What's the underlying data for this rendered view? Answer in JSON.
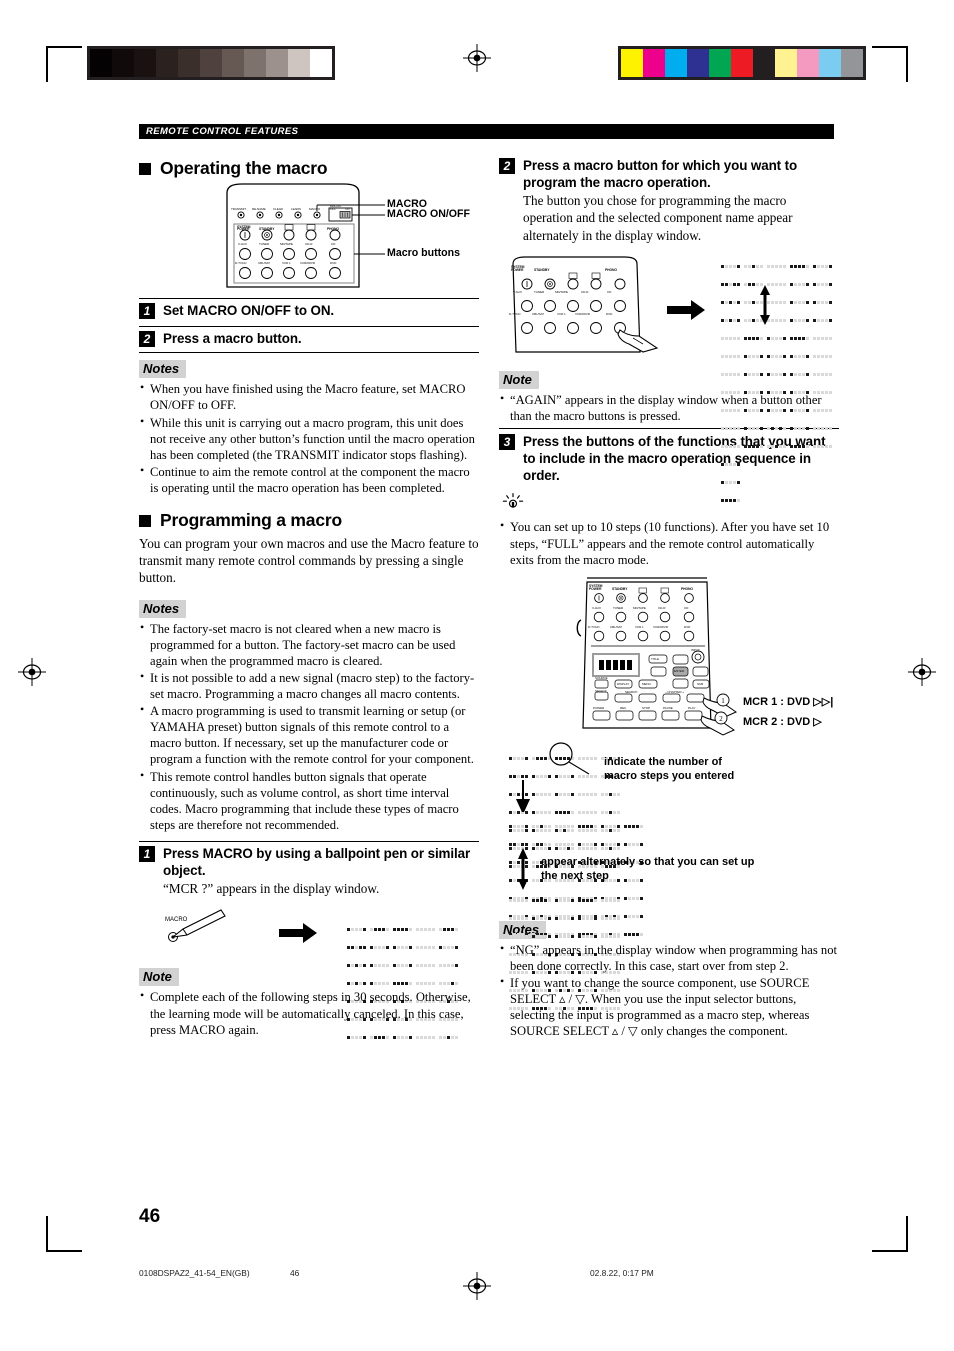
{
  "page": {
    "number": "46",
    "section_bar": "REMOTE CONTROL FEATURES",
    "footer_file": "0108DSPAZ2_41-54_EN(GB)",
    "footer_page": "46",
    "footer_date": "02.8.22, 0:17 PM"
  },
  "colors": {
    "bar_background": "#231f20",
    "notes_chip": "#d2d2d2",
    "ink": "#000000",
    "paper": "#ffffff"
  },
  "calibration": {
    "gray_swatches": [
      "#050203",
      "#100a0b",
      "#1a1211",
      "#2b211f",
      "#3b2f2c",
      "#4f423e",
      "#665853",
      "#7e726d",
      "#9c918c",
      "#cec5c1",
      "#ffffff"
    ],
    "color_swatches": [
      "#fff200",
      "#ec008c",
      "#00aeef",
      "#2e3192",
      "#00a651",
      "#ed1c24",
      "#231f20",
      "#fff391",
      "#f49ac1",
      "#7accf1",
      "#939598"
    ]
  },
  "left_column": {
    "heading": "Operating the macro",
    "figure": {
      "callouts": [
        "MACRO",
        "MACRO ON/OFF",
        "Macro buttons"
      ],
      "switch_labels": {
        "title": "MACRO ON/OFF",
        "off": "OFF",
        "on": "ON"
      },
      "top_row_labels": [
        "TRANSMIT",
        "RE-NAME",
        "CLEAR",
        "LEARN",
        "MACRO"
      ],
      "source_rows": [
        [
          "SYSTEM POWER",
          "STANDBY",
          "A",
          "B",
          "PHONO"
        ],
        [
          "V-AUX",
          "TUNER",
          "MD/TAPE",
          "CD-R",
          "CD"
        ],
        [
          "D-TV/LD",
          "CBL/SAT",
          "VCR 1",
          "VCR2/DVR",
          "DVD"
        ]
      ]
    },
    "steps": [
      {
        "num": "1",
        "title": "Set MACRO ON/OFF to ON."
      },
      {
        "num": "2",
        "title": "Press a macro button."
      }
    ],
    "notes_label": "Notes",
    "notes": [
      "When you have finished using the Macro feature, set MACRO ON/OFF to OFF.",
      "While this unit is carrying out a macro program, this unit does not receive any other button’s function until the macro operation has been completed (the TRANSMIT indicator stops flashing).",
      "Continue to aim the remote control at the component the macro is operating until the macro operation has been completed."
    ],
    "heading2": "Programming a macro",
    "intro2": "You can program your own macros and use the Macro feature to transmit many remote control commands by pressing a single button.",
    "notes_label2": "Notes",
    "notes2": [
      "The factory-set macro is not cleared when a new macro is programmed for a button. The factory-set macro can be used again when the programmed macro is cleared.",
      "It is not possible to add a new signal (macro step) to the factory-set macro. Programming a macro changes all macro contents.",
      "A macro programming is used to transmit learning or setup (or YAMAHA preset) button signals of this remote control to a macro button. If necessary, set up the manufacturer code or program a function with the remote control for your component.",
      "This remote control handles button signals that operate continuously, such as volume control, as short time interval codes. Macro programming that include these types of macro steps are therefore not recommended."
    ],
    "step1": {
      "num": "1",
      "title": "Press MACRO by using a ballpoint pen or similar object.",
      "sub": "“MCR ?” appears in the display window.",
      "pen_label": "MACRO",
      "display_text": "MCR ?"
    },
    "note_label3": "Note",
    "notes3": [
      "Complete each of the following steps in 30 seconds. Otherwise, the learning mode will be automatically canceled. In this case, press MACRO again."
    ]
  },
  "right_column": {
    "step2": {
      "num": "2",
      "title": "Press a macro button for which you want to program the macro operation.",
      "sub": "The button you chose for programming the macro operation and the selected component name appear alternately in the display window.",
      "display_top": "M1 DVD",
      "display_bottom": "DVD"
    },
    "note_label": "Note",
    "notes": [
      "“AGAIN” appears in the display window when a button other than the macro buttons is pressed."
    ],
    "step3": {
      "num": "3",
      "title": "Press the buttons of the functions that you want to include in the macro operation sequence in order.",
      "tip": "You can set up to 10 steps (10 functions). After you have set 10 steps, “FULL” appears and the remote control automatically exits from the macro mode.",
      "macro_lines": [
        "MCR 1 : DVD",
        "MCR 2 : DVD"
      ],
      "display_1": "MCR 1",
      "display_2": "M1 DVD",
      "display_3": "DVD",
      "caption_1": "indicate the number of macro steps you entered",
      "caption_2": "appear alternately so that you can set up the next step",
      "remote_labels": {
        "rows": [
          [
            "SYSTEM POWER",
            "STANDBY",
            "A",
            "B",
            "PHONO"
          ],
          [
            "V-AUX",
            "TUNER",
            "MD/TAPE",
            "CD-R",
            "CD"
          ],
          [
            "D-TV/LD",
            "CBL/SAT",
            "VCR 1",
            "VCR2/DVR",
            "DVD"
          ]
        ],
        "display_label": "DISPLAY",
        "title": "TITLE",
        "enter": "ENTER",
        "menu": "MENU",
        "source_select": "SOURCE SELECT",
        "search": "SEARCH",
        "chapter": "– CHAPTER +",
        "transport": [
          "POWER",
          "REC",
          "STOP",
          "PAUSE",
          "PLAY"
        ],
        "input": "INPUT",
        "sub": "SUB"
      }
    },
    "notes_label2": "Notes",
    "notes2": [
      "“NG” appears in the display window when programming has not been done correctly. In this case, start over from step 2.",
      "If you want to change the source component, use SOURCE SELECT ▵ / ▽. When you use the input selector buttons, selecting the input is programmed as a macro step, whereas SOURCE SELECT ▵ / ▽ only changes the component."
    ]
  }
}
